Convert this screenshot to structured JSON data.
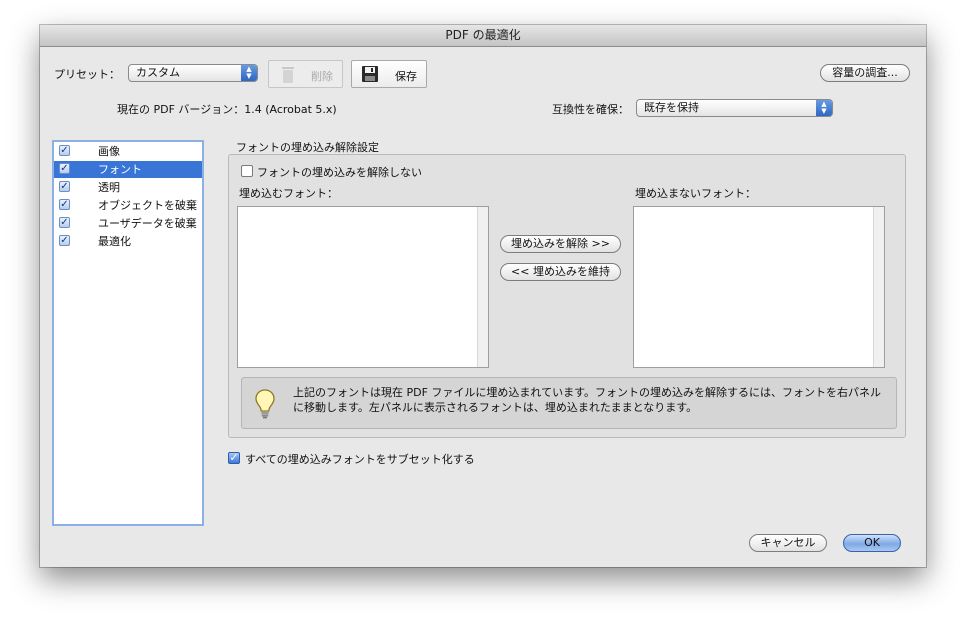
{
  "window": {
    "title": "PDF の最適化"
  },
  "toolbar": {
    "preset_label": "プリセット：",
    "preset_value": "カスタム",
    "delete_label": "削除",
    "save_label": "保存",
    "audit_label": "容量の調査..."
  },
  "version": {
    "label": "現在の PDF バージョン：1.4 (Acrobat 5.x)",
    "compat_label": "互換性を確保：",
    "compat_value": "既存を保持"
  },
  "sidebar": {
    "items": [
      {
        "label": "画像",
        "checked": true,
        "selected": false
      },
      {
        "label": "フォント",
        "checked": true,
        "selected": true
      },
      {
        "label": "透明",
        "checked": true,
        "selected": false
      },
      {
        "label": "オブジェクトを破棄",
        "checked": true,
        "selected": false
      },
      {
        "label": "ユーザデータを破棄",
        "checked": true,
        "selected": false
      },
      {
        "label": "最適化",
        "checked": true,
        "selected": false
      }
    ]
  },
  "fonts": {
    "group_title": "フォントの埋め込み解除設定",
    "no_unembed_label": "フォントの埋め込みを解除しない",
    "no_unembed_checked": false,
    "embedded_title": "埋め込むフォント：",
    "unembedded_title": "埋め込まないフォント：",
    "unembed_button": "埋め込みを解除 >>",
    "retain_button": "<< 埋め込みを維持",
    "info_line1": "上記のフォントは現在 PDF ファイルに埋め込まれています。フォントの埋め込みを解除するには、フォントを右パネル",
    "info_line2": "に移動します。左パネルに表示されるフォントは、埋め込まれたままとなります。",
    "subset_label": "すべての埋め込みフォントをサブセット化する",
    "subset_checked": true
  },
  "footer": {
    "cancel_label": "キャンセル",
    "ok_label": "OK"
  },
  "colors": {
    "selection": "#3875d7",
    "default_button": "#7fa9e6",
    "sidebar_border": "#8cb0e6"
  }
}
